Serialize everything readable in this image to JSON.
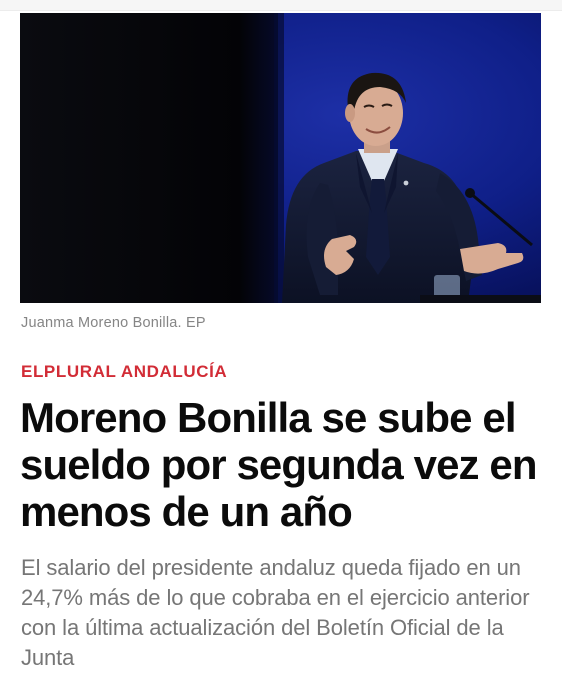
{
  "article": {
    "image": {
      "subject": "man-in-suit-gesturing-on-stage",
      "backdrop_color": "#0b1a78",
      "left_panel_color": "#05060c"
    },
    "caption": "Juanma Moreno Bonilla. EP",
    "section": "ELPLURAL ANDALUCÍA",
    "title": "Moreno Bonilla se sube el sueldo por segunda vez en menos de un año",
    "subtitle": "El salario del presidente andaluz queda fijado en un 24,7% más de lo que cobraba en el ejercicio anterior con la última actualización del Boletín Oficial de la Junta"
  },
  "colors": {
    "section_accent": "#d22c36",
    "title": "#0b0b0b",
    "subtitle": "#767676",
    "caption": "#858585"
  }
}
